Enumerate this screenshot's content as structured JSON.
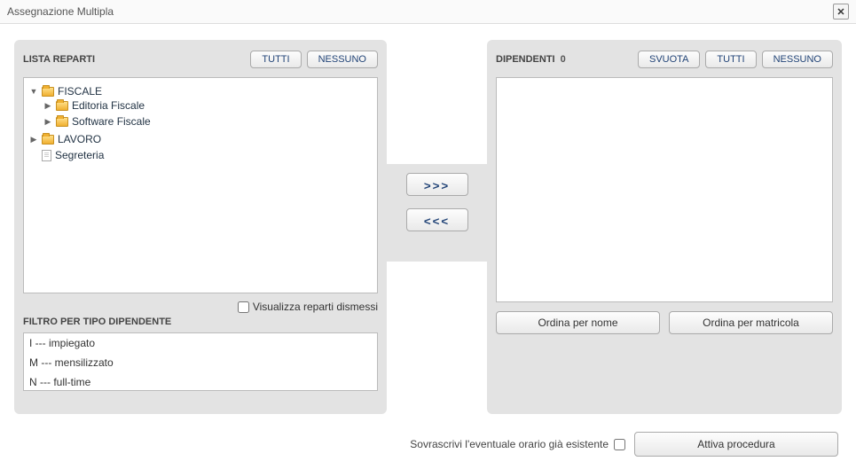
{
  "dialog": {
    "title": "Assegnazione Multipla"
  },
  "left": {
    "title": "LISTA REPARTI",
    "btn_all": "TUTTI",
    "btn_none": "NESSUNO",
    "dismissed_label": "Visualizza reparti dismessi",
    "filter_title": "FILTRO PER TIPO DIPENDENTE",
    "filter_options": [
      "I --- impiegato",
      "M --- mensilizzato",
      "N --- full-time"
    ],
    "tree": [
      {
        "label": "FISCALE",
        "expanded": true,
        "icon": "folder",
        "children": [
          {
            "label": "Editoria Fiscale",
            "expanded": false,
            "icon": "folder"
          },
          {
            "label": "Software Fiscale",
            "expanded": false,
            "icon": "folder"
          }
        ]
      },
      {
        "label": "LAVORO",
        "expanded": false,
        "icon": "folder"
      },
      {
        "label": "Segreteria",
        "expanded": null,
        "icon": "doc"
      }
    ]
  },
  "mid": {
    "add": ">>>",
    "remove": "<<<"
  },
  "right": {
    "title": "DIPENDENTI",
    "count": "0",
    "btn_empty": "SVUOTA",
    "btn_all": "TUTTI",
    "btn_none": "NESSUNO",
    "sort_name": "Ordina per nome",
    "sort_matricola": "Ordina per matricola"
  },
  "footer": {
    "overwrite_label": "Sovrascrivi l'eventuale orario già esistente",
    "activate": "Attiva procedura"
  }
}
